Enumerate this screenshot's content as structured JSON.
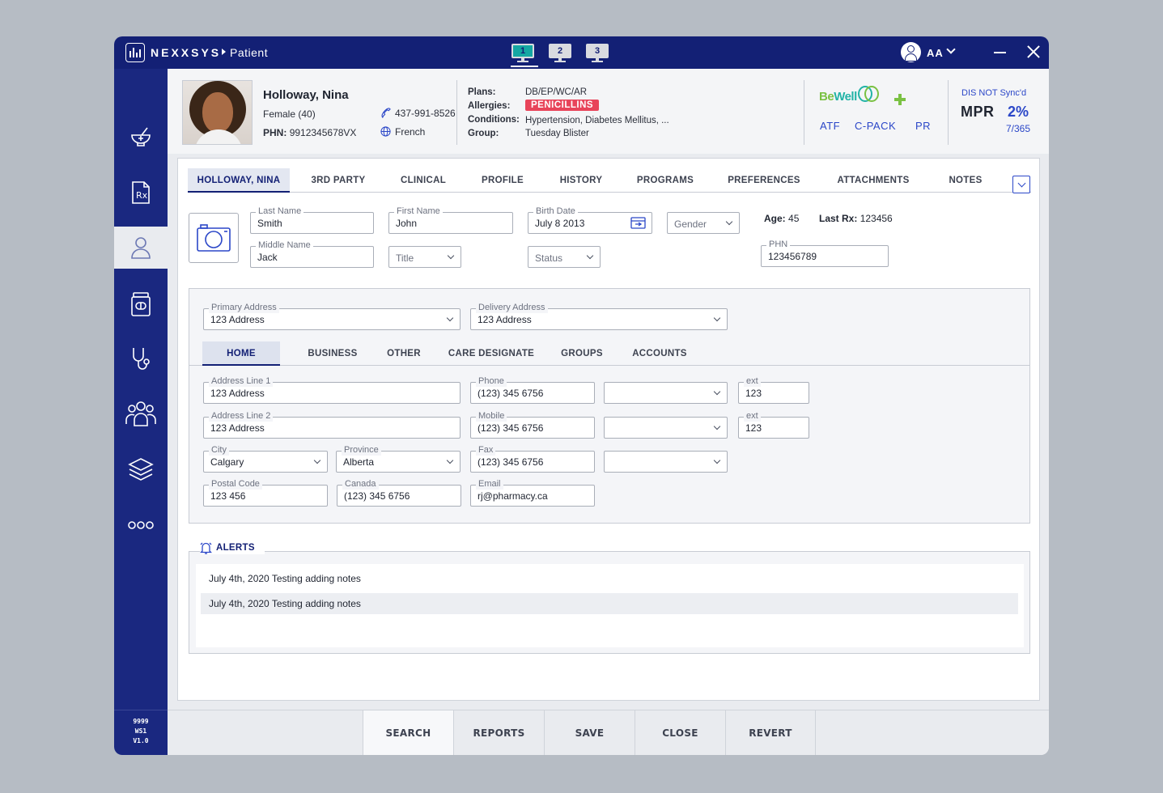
{
  "app": {
    "brand": "NEXXSYS",
    "breadcrumb": "Patient",
    "workstations": [
      "1",
      "2",
      "3"
    ],
    "user": "AA"
  },
  "sidebar": {
    "footer": [
      "9999",
      "WS1",
      "V1.0"
    ]
  },
  "patient": {
    "name": "Holloway, Nina",
    "sex_age": "Female (40)",
    "phn_label": "PHN:",
    "phn": "9912345678VX",
    "phone": "437-991-8526",
    "language": "French",
    "plans_label": "Plans:",
    "plans": "DB/EP/WC/AR",
    "allergies_label": "Allergies:",
    "allergies": "PENICILLINS",
    "conditions_label": "Conditions:",
    "conditions": "Hypertension, Diabetes Mellitus, ...",
    "group_label": "Group:",
    "group": "Tuesday Blister"
  },
  "programs": {
    "brand_a": "Be",
    "brand_b": "Well",
    "links": [
      "ATF",
      "C-PACK",
      "PR"
    ]
  },
  "mpr": {
    "status": "DIS NOT Sync'd",
    "label": "MPR",
    "value": "2%",
    "days": "7/365"
  },
  "tabs": [
    "HOLLOWAY, NINA",
    "3RD PARTY",
    "CLINICAL",
    "PROFILE",
    "HISTORY",
    "PROGRAMS",
    "PREFERENCES",
    "ATTACHMENTS",
    "NOTES"
  ],
  "form": {
    "last_name": {
      "label": "Last Name",
      "value": "Smith"
    },
    "first_name": {
      "label": "First Name",
      "value": "John"
    },
    "birth_date": {
      "label": "Birth Date",
      "value": "July 8 2013"
    },
    "gender": {
      "placeholder": "Gender"
    },
    "age_label": "Age:",
    "age": "45",
    "last_rx_label": "Last Rx:",
    "last_rx": "123456",
    "middle_name": {
      "label": "Middle Name",
      "value": "Jack"
    },
    "title": {
      "placeholder": "Title"
    },
    "status": {
      "placeholder": "Status"
    },
    "phn": {
      "label": "PHN",
      "value": "123456789"
    }
  },
  "address": {
    "primary": {
      "label": "Primary Address",
      "value": "123 Address"
    },
    "delivery": {
      "label": "Delivery Address",
      "value": "123 Address"
    },
    "subtabs": [
      "HOME",
      "BUSINESS",
      "OTHER",
      "CARE DESIGNATE",
      "GROUPS",
      "ACCOUNTS"
    ],
    "line1": {
      "label": "Address Line 1",
      "value": "123 Address"
    },
    "line2": {
      "label": "Address Line 2",
      "value": "123 Address"
    },
    "city": {
      "label": "City",
      "value": "Calgary"
    },
    "province": {
      "label": "Province",
      "value": "Alberta"
    },
    "postal": {
      "label": "Postal Code",
      "value": "123 456"
    },
    "canada": {
      "label": "Canada",
      "value": "(123) 345 6756"
    },
    "phone": {
      "label": "Phone",
      "value": "(123) 345 6756"
    },
    "mobile": {
      "label": "Mobile",
      "value": "(123) 345 6756"
    },
    "fax": {
      "label": "Fax",
      "value": "(123) 345 6756"
    },
    "email": {
      "label": "Email",
      "value": "rj@pharmacy.ca"
    },
    "ext1": {
      "label": "ext",
      "value": "123"
    },
    "ext2": {
      "label": "ext",
      "value": "123"
    }
  },
  "alerts": {
    "title": "ALERTS",
    "items": [
      "July 4th, 2020 Testing adding notes",
      "July 4th, 2020 Testing adding notes"
    ]
  },
  "actions": [
    "SEARCH",
    "REPORTS",
    "SAVE",
    "CLOSE",
    "REVERT"
  ]
}
